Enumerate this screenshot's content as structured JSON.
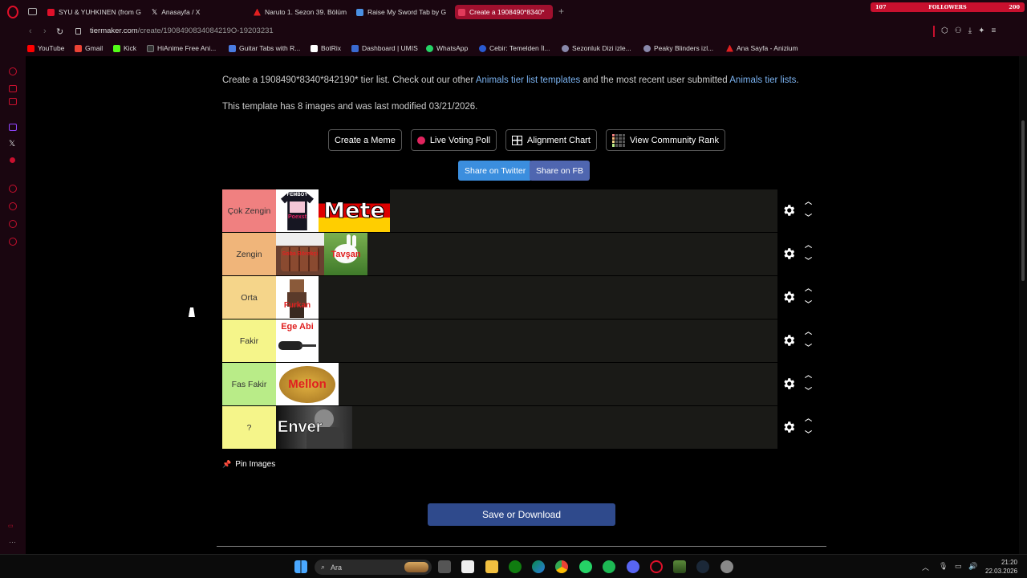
{
  "browser": {
    "tabs": [
      {
        "label": "SYU & YUHKINEN (from G",
        "color": "#e0102a",
        "active": false
      },
      {
        "label": "Anasayfa / X",
        "color": "#ffffff",
        "active": false
      },
      {
        "label": "Naruto 1. Sezon 39. Bölüm",
        "color": "#e02020",
        "active": false
      },
      {
        "label": "Raise My Sword Tab by G",
        "color": "#4a90e2",
        "active": false
      },
      {
        "label": "Create a 1908490*8340*",
        "color": "#e23a5a",
        "active": true
      }
    ],
    "followers": {
      "left": "107",
      "label": "FOLLOWERS",
      "right": "200"
    },
    "url_host": "tiermaker.com",
    "url_path": "/create/1908490834084219O-19203231",
    "bookmarks": [
      {
        "label": "YouTube",
        "color": "#ff0000"
      },
      {
        "label": "Gmail",
        "color": "#ea4335"
      },
      {
        "label": "Kick",
        "color": "#53fc18"
      },
      {
        "label": "HiAnime Free Ani...",
        "color": "#333333"
      },
      {
        "label": "Guitar Tabs with R...",
        "color": "#4a7be0"
      },
      {
        "label": "BotRix",
        "color": "#ffffff"
      },
      {
        "label": "Dashboard | UMIS",
        "color": "#3a6ad0"
      },
      {
        "label": "WhatsApp",
        "color": "#25d366"
      },
      {
        "label": "Cebir: Temelden İl...",
        "color": "#2a5ad0"
      },
      {
        "label": "Sezonluk Dizi izle...",
        "color": "#8888aa"
      },
      {
        "label": "Peaky Blinders izl...",
        "color": "#8888aa"
      },
      {
        "label": "Ana Sayfa - Anizium",
        "color": "#e02020"
      }
    ]
  },
  "page": {
    "description_prefix": "Create a 1908490*8340*842190* tier list. Check out our other ",
    "link_templates": "Animals tier list templates",
    "description_mid": " and the most recent user submitted ",
    "link_lists": "Animals tier lists",
    "description_suffix": ".",
    "modified": "This template has 8 images and was last modified 03/21/2026.",
    "buttons": {
      "meme": "Create a Meme",
      "poll": "Live Voting Poll",
      "alignment": "Alignment Chart",
      "community": "View Community Rank"
    },
    "share_twitter": "Share on Twitter",
    "share_fb": "Share on FB",
    "tiers": [
      {
        "label": "Çok Zengin",
        "color": "#f08080"
      },
      {
        "label": "Zengin",
        "color": "#f0b57a"
      },
      {
        "label": "Orta",
        "color": "#f5d58a"
      },
      {
        "label": "Fakir",
        "color": "#f5f58a"
      },
      {
        "label": "Fas Fakir",
        "color": "#b9ec88"
      },
      {
        "label": "?",
        "color": "#f5f58a"
      }
    ],
    "tiles": {
      "femboy_top": "FEMBOY",
      "femboy_bottom": "Poexst",
      "mete": "Mete",
      "soba": "Soba Börekçi",
      "tavsan": "Tavşan",
      "furkan": "Furkan",
      "ege": "Ege Abi",
      "mellon": "Mellon",
      "enver": "Enver"
    },
    "pin_label": "Pin Images",
    "save_label": "Save or Download"
  },
  "taskbar": {
    "search_label": "Ara",
    "time": "21:20",
    "date": "22.03.2026"
  }
}
